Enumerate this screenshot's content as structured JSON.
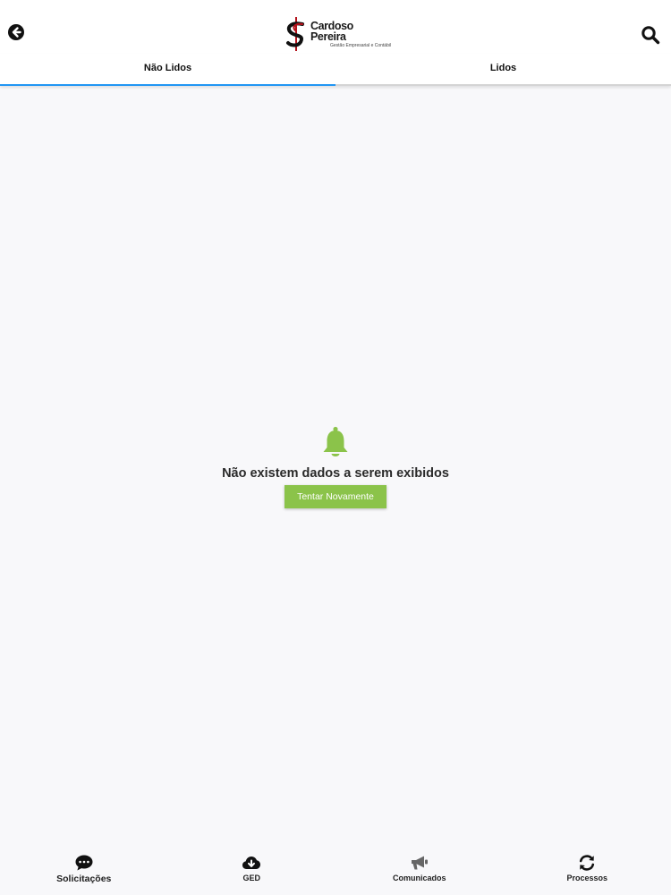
{
  "header": {
    "logo": {
      "name": "Cardoso Pereira",
      "tagline": "Gestão Empresarial e Contábil"
    },
    "icons": {
      "back": "arrow-left-circle-icon",
      "search": "search-icon"
    }
  },
  "tabs": [
    {
      "label": "Não Lidos",
      "active": true
    },
    {
      "label": "Lidos",
      "active": false
    }
  ],
  "empty_state": {
    "icon": "bell-icon",
    "message": "Não existem dados a serem exibidos",
    "retry_label": "Tentar Novamente"
  },
  "bottom_nav": [
    {
      "label": "Solicitações",
      "icon": "chat-icon"
    },
    {
      "label": "GED",
      "icon": "cloud-download-icon"
    },
    {
      "label": "Comunicados",
      "icon": "megaphone-icon"
    },
    {
      "label": "Processos",
      "icon": "refresh-icon"
    }
  ],
  "colors": {
    "accent": "#2196f3",
    "success": "#8bc34a",
    "logo_red": "#b3121b",
    "background": "#f8f8fa"
  }
}
